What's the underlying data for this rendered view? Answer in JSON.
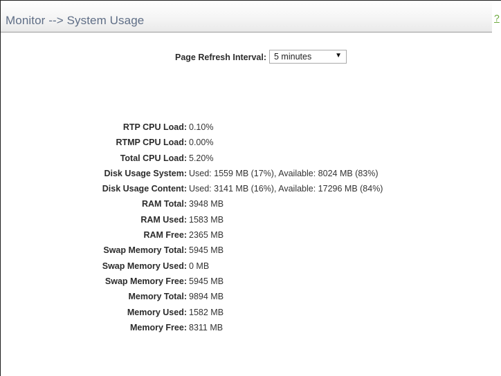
{
  "header": {
    "title": "Monitor --> System Usage",
    "help": "?"
  },
  "refresh": {
    "label": "Page Refresh Interval:",
    "selected": "5 minutes",
    "chevron_icon": "chevron-down-icon"
  },
  "stats": [
    {
      "label": "RTP CPU Load:",
      "value": "0.10%"
    },
    {
      "label": "RTMP CPU Load:",
      "value": "0.00%"
    },
    {
      "label": "Total CPU Load:",
      "value": "5.20%"
    },
    {
      "label": "Disk Usage System:",
      "value": "Used: 1559 MB (17%), Available: 8024 MB (83%)"
    },
    {
      "label": "Disk Usage Content:",
      "value": "Used: 3141 MB (16%), Available: 17296 MB (84%)"
    },
    {
      "label": "RAM Total:",
      "value": "3948 MB"
    },
    {
      "label": "RAM Used:",
      "value": "1583 MB"
    },
    {
      "label": "RAM Free:",
      "value": "2365 MB"
    },
    {
      "label": "Swap Memory Total:",
      "value": "5945 MB"
    },
    {
      "label": "Swap Memory Used:",
      "value": "0 MB"
    },
    {
      "label": "Swap Memory Free:",
      "value": "5945 MB"
    },
    {
      "label": "Memory Total:",
      "value": "9894 MB"
    },
    {
      "label": "Memory Used:",
      "value": "1582 MB"
    },
    {
      "label": "Memory Free:",
      "value": "8311 MB"
    }
  ],
  "colors": {
    "title": "#5f6e86",
    "help_link": "#6aa83a",
    "label": "#2b2b2b",
    "value": "#333333"
  }
}
